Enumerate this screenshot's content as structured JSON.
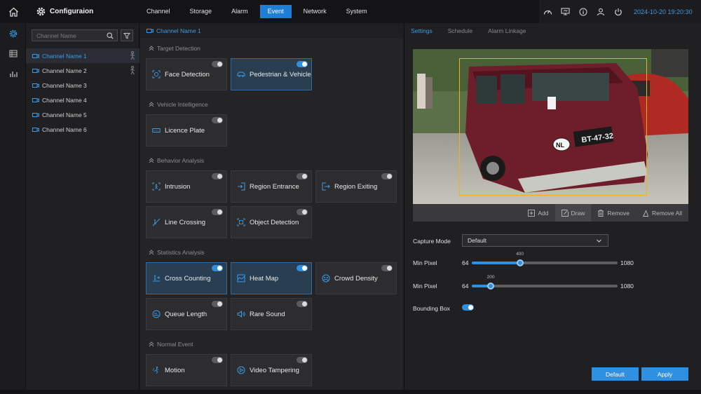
{
  "topbar": {
    "title": "Configuraion",
    "tabs": [
      {
        "label": "Channel"
      },
      {
        "label": "Storage"
      },
      {
        "label": "Alarm"
      },
      {
        "label": "Event",
        "active": true
      },
      {
        "label": "Network"
      },
      {
        "label": "System"
      }
    ],
    "datetime": "2024-10-20  19:20:30",
    "icons": [
      "dashboard-icon",
      "monitor-icon",
      "info-icon",
      "user-icon",
      "power-icon"
    ]
  },
  "rail": {
    "icons": [
      "settings-icon",
      "list-icon",
      "stats-icon"
    ]
  },
  "sidebar": {
    "search_placeholder": "Channel Name",
    "channels": [
      {
        "label": "Channel Name 1"
      },
      {
        "label": "Channel Name 2"
      },
      {
        "label": "Channel Name 3"
      },
      {
        "label": "Channel Name 4"
      },
      {
        "label": "Channel Name 5"
      },
      {
        "label": "Channel Name 6"
      }
    ]
  },
  "middle": {
    "header": "Channel Name 1",
    "sections": {
      "target": "Target Detection",
      "vehicle": "Vehicle Intelligence",
      "behavior": "Behavior Analysis",
      "statistics": "Statistics Analysis",
      "normal": "Normal Event"
    },
    "cards": {
      "face": "Face Detection",
      "pedestrian": "Pedestrian & Vehicle",
      "licence": "Licence Plate",
      "intrusion": "Intrusion",
      "region_entrance": "Region Entrance",
      "region_exiting": "Region Exiting",
      "line_crossing": "Line Crossing",
      "object_detection": "Object Detection",
      "cross_counting": "Cross Counting",
      "heat_map": "Heat Map",
      "crowd_density": "Crowd Density",
      "queue_length": "Queue Length",
      "rare_sound": "Rare Sound",
      "motion": "Motion",
      "video_tampering": "Video Tampering"
    }
  },
  "right": {
    "tabs": [
      "Settings",
      "Schedule",
      "Alarm Linkage"
    ],
    "plate_text": "BT-47-32",
    "country_text": "NL",
    "tools": {
      "add": "Add",
      "draw": "Draw",
      "remove": "Remove",
      "remove_all": "Remove All"
    },
    "capture_mode_label": "Capture Mode",
    "capture_mode_value": "Default",
    "min_pixel_1": {
      "label": "Min Pixel",
      "min": "64",
      "max": "1080",
      "value": "400",
      "fraction": 0.33
    },
    "min_pixel_2": {
      "label": "Min Pixel",
      "min": "64",
      "max": "1080",
      "value": "200",
      "fraction": 0.13
    },
    "bounding_box_label": "Bounding Box",
    "buttons": {
      "default": "Default",
      "apply": "Apply"
    }
  },
  "colors": {
    "accent": "#2f8fe0",
    "bbox": "#f0b020"
  }
}
